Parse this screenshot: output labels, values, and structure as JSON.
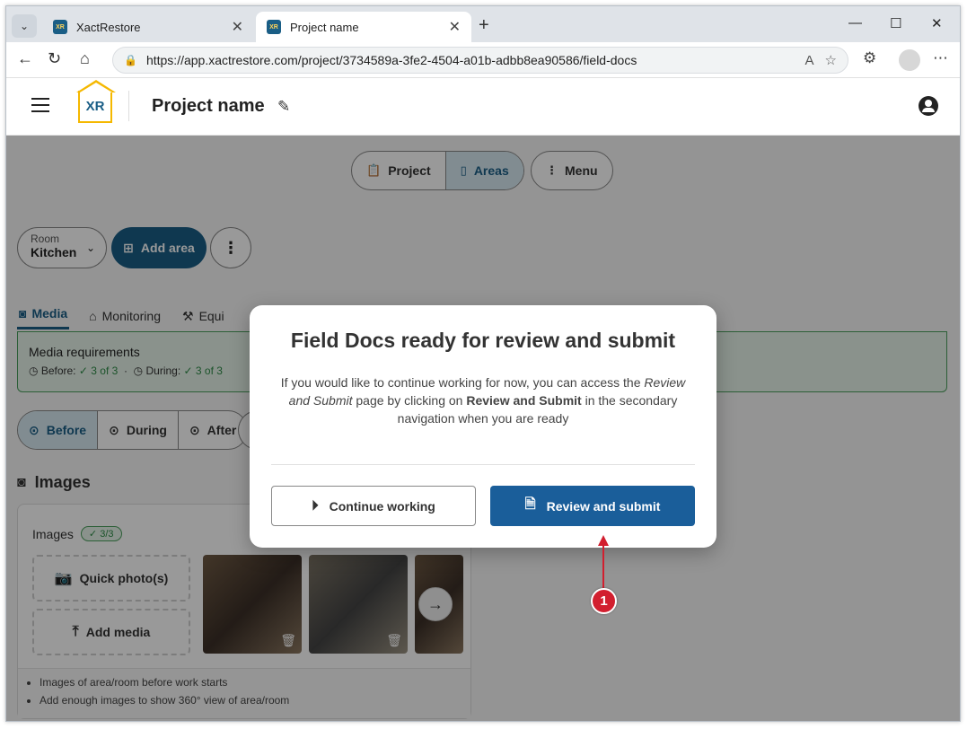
{
  "browser": {
    "tabs": [
      {
        "label": "XactRestore",
        "favicon": "XR"
      },
      {
        "label": "Project name",
        "favicon": "XR"
      }
    ],
    "url": "https://app.xactrestore.com/project/3734589a-3fe2-4504-a01b-adbb8ea90586/field-docs"
  },
  "header": {
    "logo_text": "XR",
    "project_title": "Project name"
  },
  "secondary_nav": {
    "project_label": "Project",
    "areas_label": "Areas",
    "menu_label": "Menu"
  },
  "room": {
    "small_label": "Room",
    "value": "Kitchen",
    "add_area_label": "Add area"
  },
  "tabs": [
    "Media",
    "Monitoring",
    "Equi"
  ],
  "media_requirements": {
    "title": "Media requirements",
    "before_label": "Before:",
    "before_value": "3 of 3",
    "during_label": "During:",
    "during_value": "3 of 3"
  },
  "phases": [
    "Before",
    "During",
    "After"
  ],
  "images": {
    "section_title": "Images",
    "card_title": "Images",
    "badge": "3/3",
    "quick_photo_label": "Quick photo(s)",
    "add_media_label": "Add media",
    "hints": [
      "Images of area/room before work starts",
      "Add enough images to show 360° view of area/room"
    ]
  },
  "modal": {
    "title": "Field Docs ready for review and submit",
    "body_1": "If you would like to continue working for now, you can access the ",
    "body_em": "Review and Submit",
    "body_2": " page by clicking on ",
    "body_strong": "Review and Submit",
    "body_3": " in the secondary navigation when you are ready",
    "continue_label": "Continue working",
    "review_label": "Review and submit"
  },
  "callout": {
    "number": "1"
  },
  "colors": {
    "brand_blue": "#1a5e86",
    "primary_button": "#1a5e9a",
    "success_green": "#2e8b47",
    "callout_red": "#d21f2f",
    "logo_yellow": "#f5b800"
  }
}
